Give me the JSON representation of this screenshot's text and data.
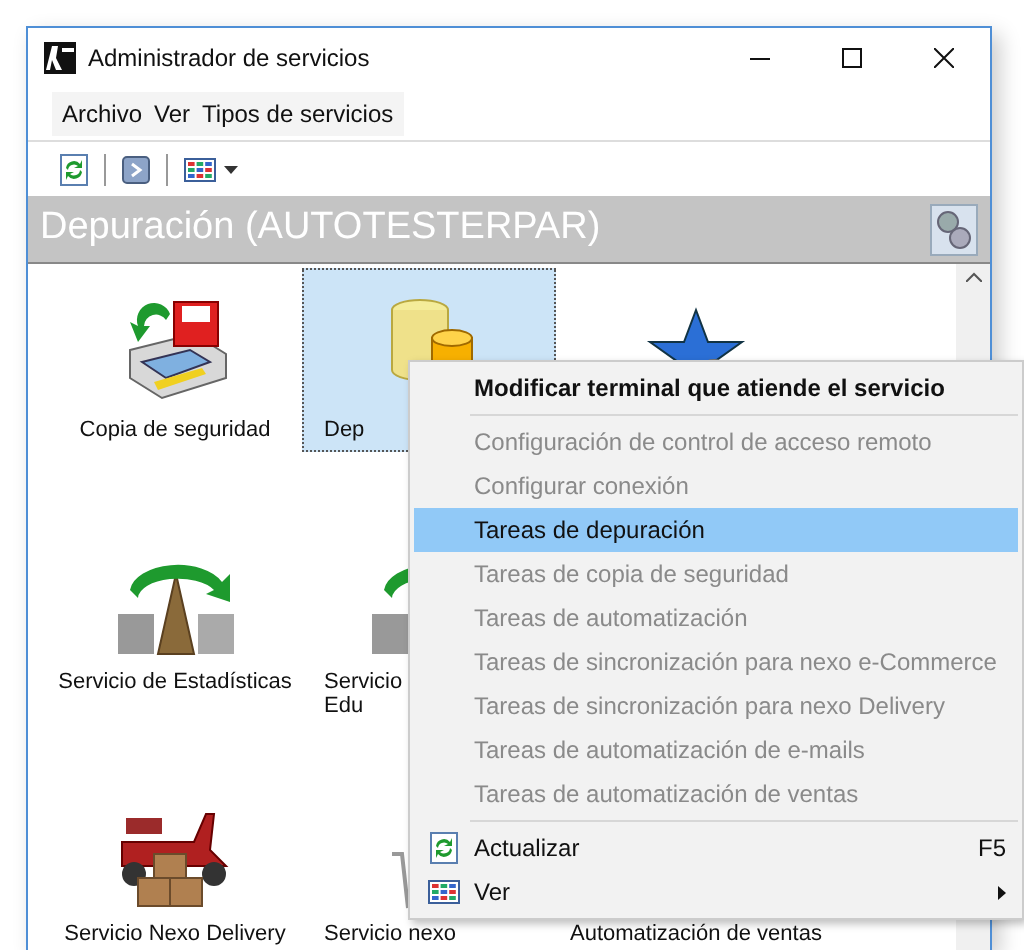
{
  "window": {
    "title": "Administrador de servicios"
  },
  "menu_bar": [
    "Archivo",
    "Ver",
    "Tipos de servicios"
  ],
  "toolbar": [
    {
      "kind": "refresh"
    },
    {
      "kind": "terminal"
    },
    {
      "kind": "view",
      "dropdown": true
    }
  ],
  "header": {
    "title": "Depuración (AUTOTESTERPAR)"
  },
  "service_rows": [
    [
      {
        "kind": "backup",
        "label": "Copia de seguridad",
        "selected": false
      },
      {
        "kind": "database",
        "label": "Dep",
        "selected": true
      },
      {
        "kind": "star",
        "selected": false
      }
    ],
    [
      {
        "kind": "stats",
        "label": "Servicio de Estadísticas",
        "selected": false
      },
      {
        "kind": "stats",
        "label": "Servicio\nEdu",
        "selected": false
      }
    ],
    [
      {
        "kind": "scooter",
        "label": "Servicio Nexo Delivery",
        "selected": false
      },
      {
        "kind": "cart",
        "label": "Servicio nexo",
        "selected": false
      },
      {
        "kind": "none",
        "label": "Automatización de ventas",
        "selected": false
      }
    ]
  ],
  "context_menu": [
    {
      "kind": "item",
      "label": "Modificar terminal que atiende el servicio",
      "bold": true,
      "disabled": false,
      "selected": false
    },
    {
      "kind": "separator"
    },
    {
      "kind": "item",
      "label": "Configuración de control de acceso remoto",
      "disabled": true,
      "selected": false
    },
    {
      "kind": "item",
      "label": "Configurar conexión",
      "disabled": true,
      "selected": false
    },
    {
      "kind": "item",
      "label": "Tareas de depuración",
      "disabled": false,
      "selected": true
    },
    {
      "kind": "item",
      "label": "Tareas de copia de seguridad",
      "disabled": true,
      "selected": false
    },
    {
      "kind": "item",
      "label": "Tareas de automatización",
      "disabled": true,
      "selected": false
    },
    {
      "kind": "item",
      "label": "Tareas de sincronización para nexo e-Commerce",
      "disabled": true,
      "selected": false
    },
    {
      "kind": "item",
      "label": "Tareas de sincronización para nexo Delivery",
      "disabled": true,
      "selected": false
    },
    {
      "kind": "item",
      "label": "Tareas de automatización de e-mails",
      "disabled": true,
      "selected": false
    },
    {
      "kind": "item",
      "label": "Tareas de automatización de ventas",
      "disabled": true,
      "selected": false
    },
    {
      "kind": "separator"
    },
    {
      "kind": "refresh",
      "label": "Actualizar",
      "shortcut": "F5",
      "disabled": false,
      "selected": false
    },
    {
      "kind": "view",
      "label": "Ver",
      "submenu": true,
      "disabled": false,
      "selected": false
    }
  ]
}
